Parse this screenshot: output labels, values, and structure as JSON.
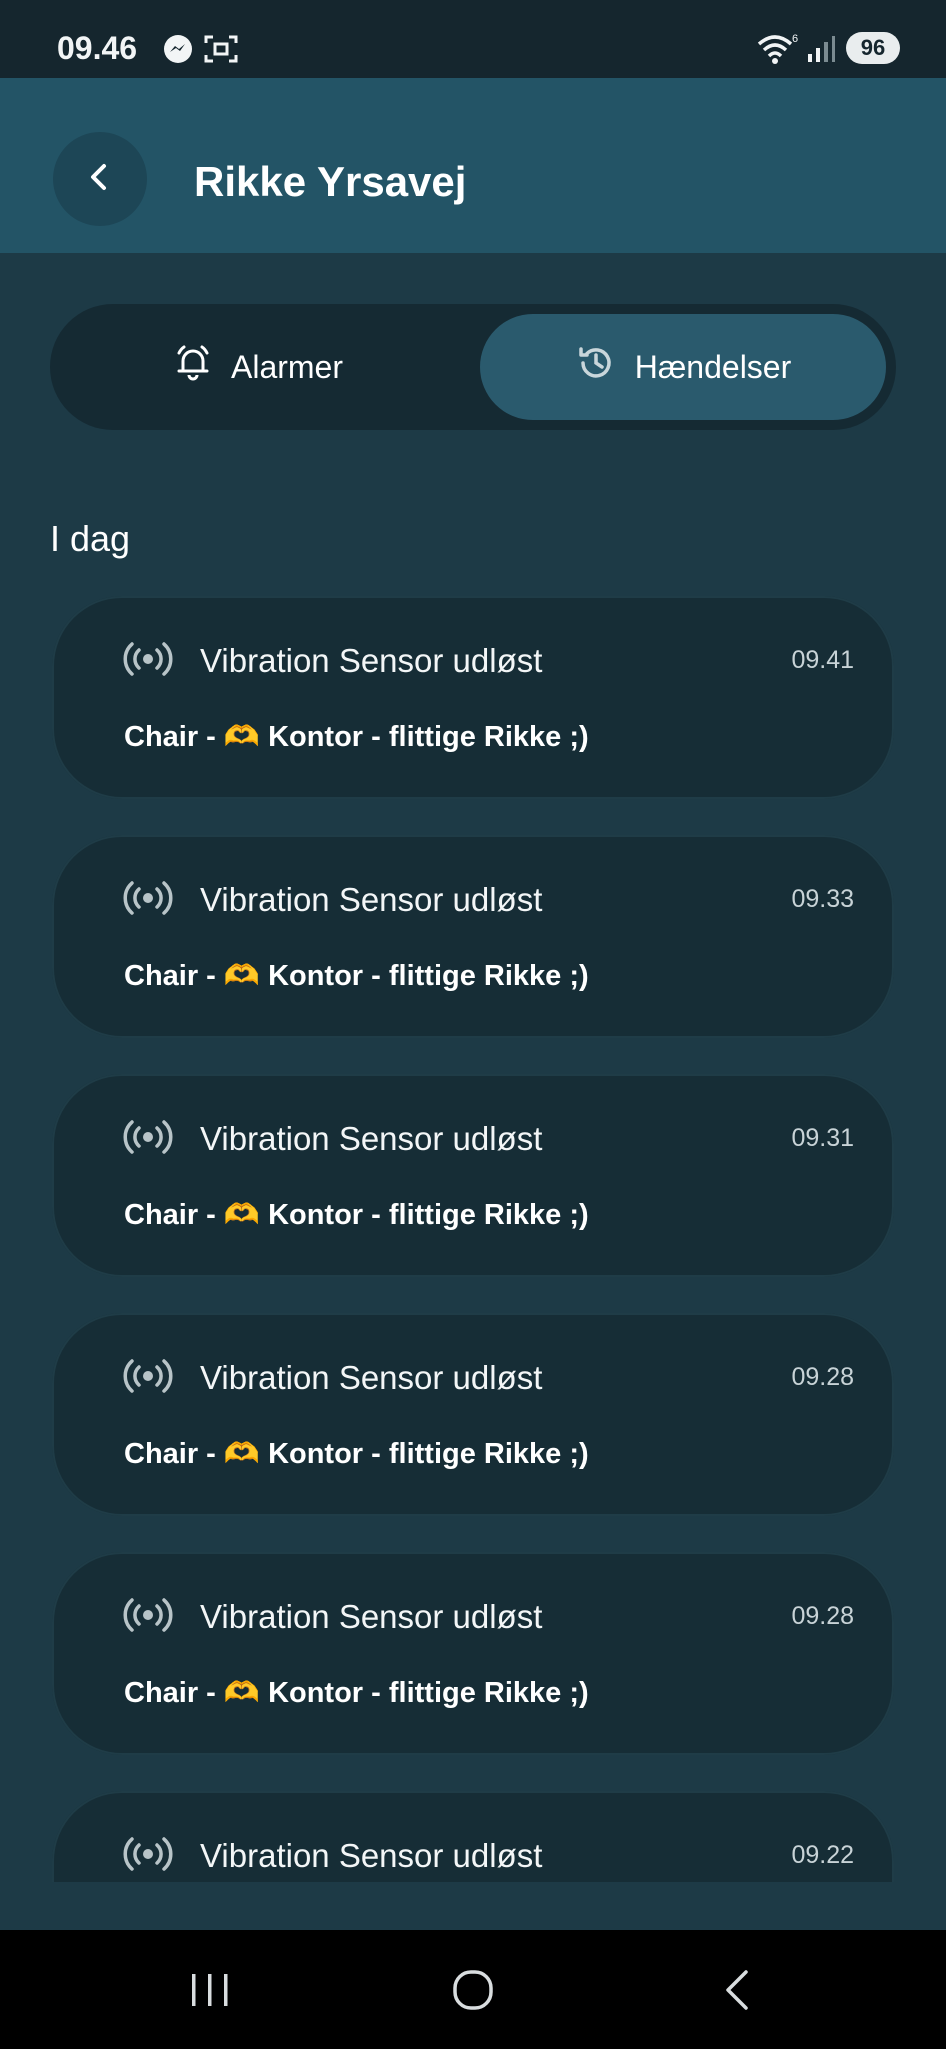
{
  "status_bar": {
    "time": "09.46",
    "battery": "96",
    "icons": [
      "messenger-icon",
      "screenshot-icon",
      "wifi-icon",
      "signal-icon"
    ]
  },
  "app_bar": {
    "title": "Rikke Yrsavej",
    "back_icon": "chevron-left-icon"
  },
  "tabs": [
    {
      "label": "Alarmer",
      "icon": "bell-icon",
      "selected": false
    },
    {
      "label": "Hændelser",
      "icon": "history-icon",
      "selected": true
    }
  ],
  "section": {
    "title": "I dag"
  },
  "events": [
    {
      "title": "Vibration Sensor udløst",
      "time": "09.41",
      "subtitle": "Chair - 🫶 Kontor - flittige Rikke ;)"
    },
    {
      "title": "Vibration Sensor udløst",
      "time": "09.33",
      "subtitle": "Chair - 🫶 Kontor - flittige Rikke ;)"
    },
    {
      "title": "Vibration Sensor udløst",
      "time": "09.31",
      "subtitle": "Chair - 🫶 Kontor - flittige Rikke ;)"
    },
    {
      "title": "Vibration Sensor udløst",
      "time": "09.28",
      "subtitle": "Chair - 🫶 Kontor - flittige Rikke ;)"
    },
    {
      "title": "Vibration Sensor udløst",
      "time": "09.28",
      "subtitle": "Chair - 🫶 Kontor - flittige Rikke ;)"
    },
    {
      "title": "Vibration Sensor udløst",
      "time": "09.22",
      "subtitle": ""
    }
  ],
  "nav_bar": {
    "icons": [
      "recents-icon",
      "home-icon",
      "back-icon"
    ]
  },
  "colors": {
    "background": "#1d3a46",
    "app_bar": "#235466",
    "card": "#162d36",
    "selected_tab": "#2a5a6d"
  }
}
